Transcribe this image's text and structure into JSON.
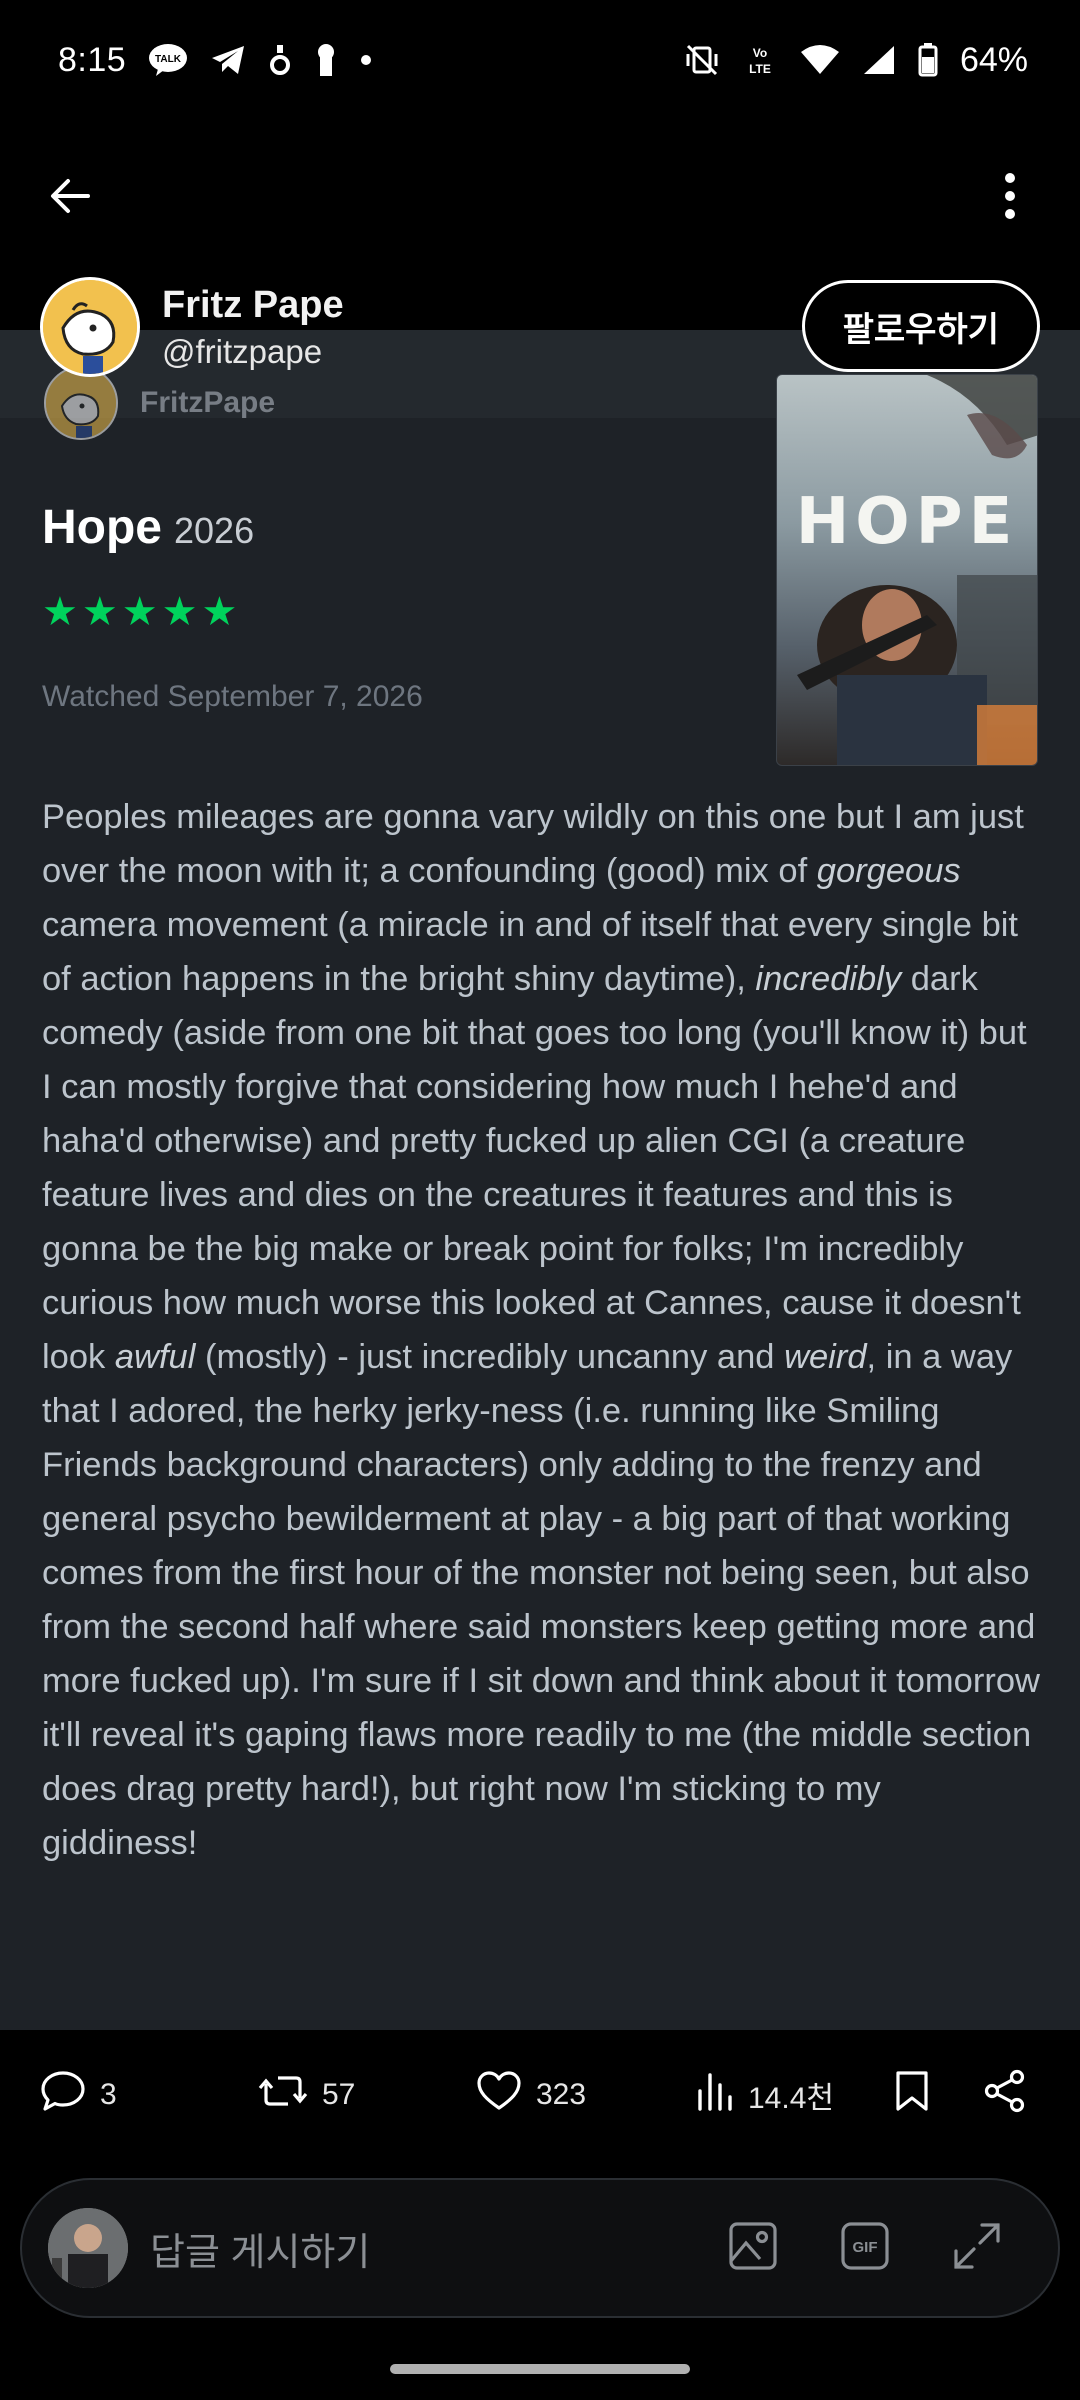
{
  "status_bar": {
    "time": "8:15",
    "battery": "64%",
    "notification_icons": [
      "kakaotalk-icon",
      "telegram-icon",
      "app-icon",
      "keyhole-icon",
      "dot-icon"
    ],
    "system_icons": [
      "vibrate-off-icon",
      "volte-icon",
      "wifi-icon",
      "signal-icon",
      "battery-icon"
    ]
  },
  "header": {
    "back_icon": "arrow-left-icon",
    "more_icon": "more-vertical-icon"
  },
  "profile": {
    "display_name": "Fritz Pape",
    "handle": "@fritzpape",
    "follow_label": "팔로우하기"
  },
  "card": {
    "author_name": "FritzPape",
    "film_title": "Hope",
    "film_year": "2026",
    "rating_stars": 5,
    "star_char": "★",
    "watched": "Watched September 7, 2026",
    "poster_title": "HOPE",
    "review": {
      "p1": "Peoples mileages are gonna vary wildly on this one but I am just over the moon with it; a confounding (good) mix of ",
      "em1": "gorgeous",
      "p2": " camera movement (a miracle in and of itself that every single bit of action happens in the bright shiny daytime), ",
      "em2": "incredibly",
      "p3": " dark comedy (aside from one bit that goes too long (you'll know it) but I can mostly forgive that considering how much I hehe'd and haha'd otherwise) and pretty fucked up alien CGI (a creature feature lives and dies on the creatures it features and this is gonna be the big make or break point for folks; I'm incredibly curious how much worse this looked at Cannes, cause it doesn't look ",
      "em3": "awful",
      "p4": " (mostly) - just incredibly uncanny and ",
      "em4": "weird",
      "p5": ", in a way that I adored, the herky jerky-ness (i.e. running like Smiling Friends background characters) only adding to the frenzy and general psycho bewilderment at play - a big part of that working comes from the first hour of the monster not being seen, but also from the second half where said monsters keep getting more and more fucked up). I'm sure if I sit down and think about it tomorrow it'll reveal it's gaping flaws more readily to me (the middle section does drag pretty hard!), but right now I'm sticking to my giddiness!"
    }
  },
  "actions": {
    "replies": "3",
    "reposts": "57",
    "likes": "323",
    "views": "14.4천"
  },
  "composer": {
    "placeholder": "답글 게시하기"
  }
}
